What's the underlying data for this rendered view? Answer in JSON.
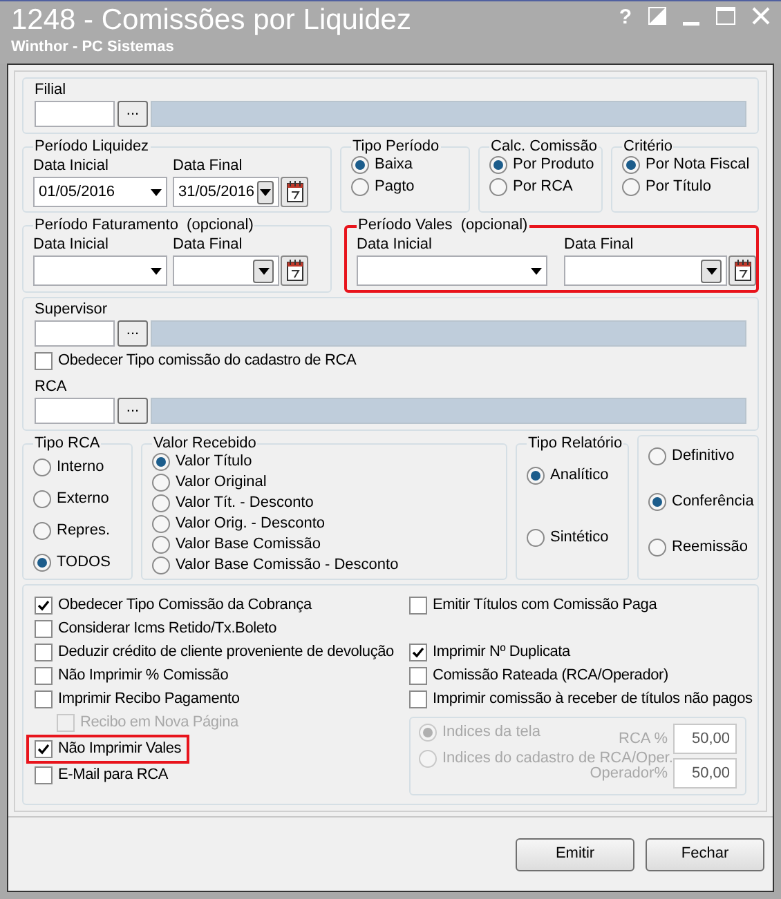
{
  "window": {
    "title": "1248 - Comissões por Liquidez",
    "subtitle": "Winthor - PC Sistemas",
    "help": "?"
  },
  "filial": {
    "label": "Filial",
    "button": "..."
  },
  "periodo_liquidez": {
    "title": "Período Liquidez",
    "highlighted": false,
    "fields": [
      {
        "label": "Data Inicial",
        "value": "01/05/2016",
        "kind": "dropdown"
      },
      {
        "label": "Data Final",
        "value": "31/05/2016",
        "kind": "calendar"
      }
    ]
  },
  "tipo_periodo": {
    "title": "Tipo Período",
    "options": [
      {
        "label": "Baixa",
        "selected": true
      },
      {
        "label": "Pagto",
        "selected": false
      }
    ]
  },
  "calc_comissao": {
    "title": "Calc. Comissão",
    "options": [
      {
        "label": "Por Produto",
        "selected": true
      },
      {
        "label": "Por RCA",
        "selected": false
      }
    ]
  },
  "criterio": {
    "title": "Critério",
    "options": [
      {
        "label": "Por Nota Fiscal",
        "selected": true
      },
      {
        "label": "Por Título",
        "selected": false
      }
    ]
  },
  "periodo_faturamento": {
    "title": "Período Faturamento  (opcional)",
    "highlighted": false,
    "fields": [
      {
        "label": "Data Inicial",
        "kind": "dropdown"
      },
      {
        "label": "Data Final",
        "kind": "calendar"
      }
    ]
  },
  "periodo_vales": {
    "title": "Período Vales  (opcional)",
    "highlighted": true,
    "fields": [
      {
        "label": "Data Inicial",
        "kind": "dropdown"
      },
      {
        "label": "Data Final",
        "kind": "calendar"
      }
    ]
  },
  "supervisor": {
    "label": "Supervisor",
    "button": "..."
  },
  "obedecer_tipo_comissao": {
    "label": "Obedecer Tipo comissão do cadastro de RCA",
    "checked": false
  },
  "rca": {
    "label": "RCA",
    "button": "..."
  },
  "tipo_rca": {
    "title": "Tipo RCA",
    "options": [
      {
        "label": "Interno",
        "selected": false
      },
      {
        "label": "Externo",
        "selected": false
      },
      {
        "label": "Repres.",
        "selected": false
      },
      {
        "label": "TODOS",
        "selected": true
      }
    ]
  },
  "valor_recebido": {
    "title": "Valor Recebido",
    "options": [
      {
        "label": "Valor Título",
        "selected": true
      },
      {
        "label": "Valor Original",
        "selected": false
      },
      {
        "label": "Valor Tít. - Desconto",
        "selected": false
      },
      {
        "label": "Valor Orig. - Desconto",
        "selected": false
      },
      {
        "label": "Valor Base Comissão",
        "selected": false
      },
      {
        "label": "Valor Base Comissão - Desconto",
        "selected": false
      }
    ]
  },
  "tipo_relatorio": {
    "title": "Tipo Relatório",
    "options": [
      {
        "label": "Analítico",
        "selected": true
      },
      {
        "label": "Sintético",
        "selected": false
      }
    ]
  },
  "modo_emissao": {
    "options": [
      {
        "label": "Definitivo",
        "selected": false
      },
      {
        "label": "Conferência",
        "selected": true
      },
      {
        "label": "Reemissão",
        "selected": false
      }
    ]
  },
  "opcoes_esquerda": [
    {
      "label": "Obedecer Tipo Comissão da Cobrança",
      "checked": true,
      "disabled": false,
      "highlighted": false
    },
    {
      "label": "Considerar Icms Retido/Tx.Boleto",
      "checked": false,
      "disabled": false,
      "highlighted": false
    },
    {
      "label": "Deduzir crédito de cliente proveniente de devolução",
      "checked": false,
      "disabled": false,
      "highlighted": false
    },
    {
      "label": "Não Imprimir % Comissão",
      "checked": false,
      "disabled": false,
      "highlighted": false
    },
    {
      "label": "Imprimir Recibo Pagamento",
      "checked": false,
      "disabled": false,
      "highlighted": false,
      "children": [
        {
          "label": "Recibo em Nova Página",
          "checked": false,
          "disabled": true
        }
      ]
    },
    {
      "label": "Não Imprimir Vales",
      "checked": true,
      "disabled": false,
      "highlighted": true
    },
    {
      "label": "E-Mail para RCA",
      "checked": false,
      "disabled": false,
      "highlighted": false
    }
  ],
  "opcoes_direita": [
    {
      "label": "Emitir Títulos com Comissão Paga",
      "checked": false,
      "disabled": false
    },
    {
      "label": "Imprimir Nº Duplicata",
      "checked": true,
      "disabled": false
    },
    {
      "label": "Comissão Rateada (RCA/Operador)",
      "checked": false,
      "disabled": false
    },
    {
      "label": "Imprimir comissão à receber de títulos não pagos",
      "checked": false,
      "disabled": false
    }
  ],
  "indices": {
    "disabled": true,
    "options": [
      {
        "label": "Indices da tela",
        "selected": true
      },
      {
        "label": "Indices do cadastro de RCA/Oper.",
        "selected": false
      }
    ],
    "rates": [
      {
        "label": "RCA %",
        "value": "50,00"
      },
      {
        "label": "Operador%",
        "value": "50,00"
      }
    ]
  },
  "buttons": [
    {
      "label": "Emitir"
    },
    {
      "label": "Fechar"
    }
  ]
}
